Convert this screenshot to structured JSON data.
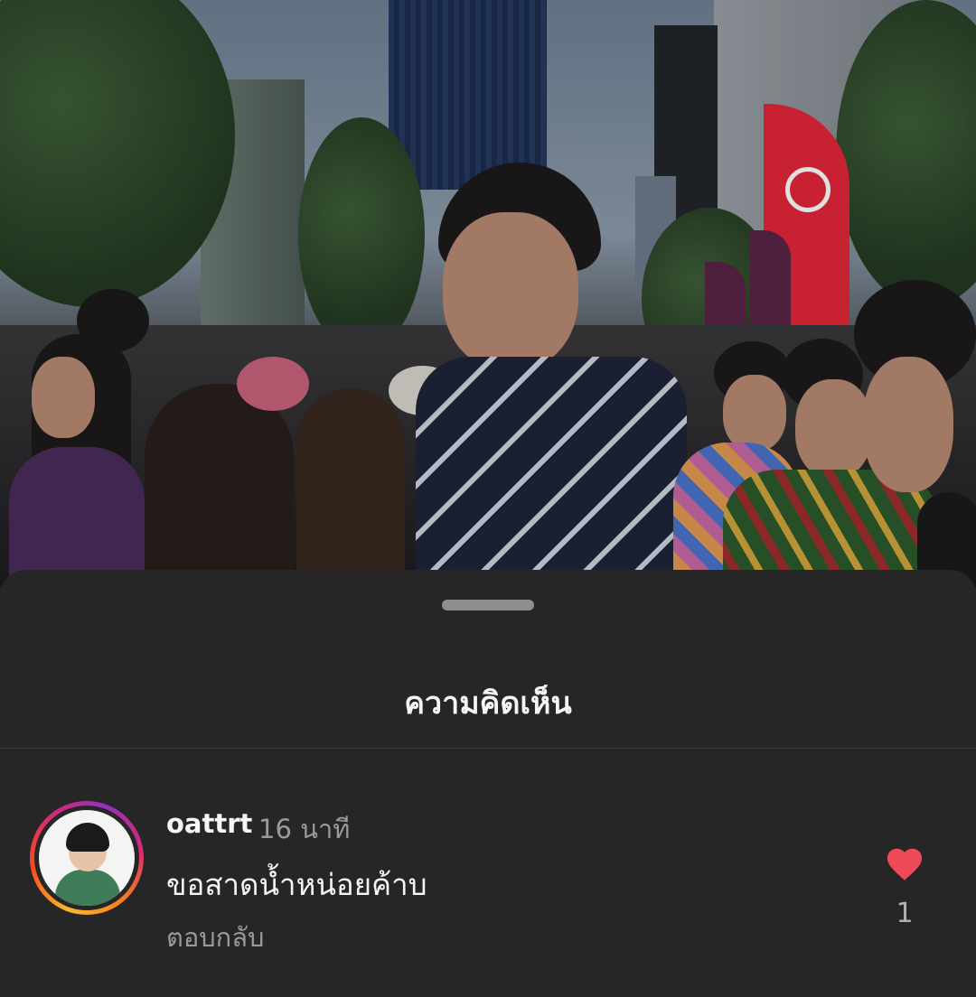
{
  "sheet": {
    "title": "ความคิดเห็น"
  },
  "comments": [
    {
      "username": "oattrt",
      "time": "16 นาที",
      "text": "ขอสาดน้ำหน่อยค้าบ",
      "reply_label": "ตอบกลับ",
      "likes": "1",
      "liked": true
    }
  ],
  "colors": {
    "sheet_background": "#262626",
    "heart": "#ed4956",
    "primary_text": "#f5f5f5",
    "secondary_text": "#9a9a9a"
  },
  "icons": {
    "like": "heart-icon"
  }
}
